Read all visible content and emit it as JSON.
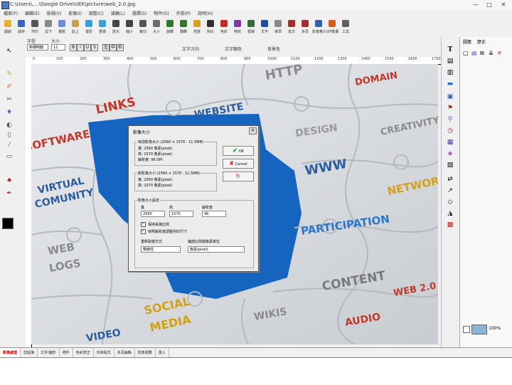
{
  "titlebar": {
    "title": "C:\\Users\\....\\Google Drive\\UEK\\picture\\web_2.0.jpg",
    "minimize": "—",
    "maximize": "□",
    "close": "✕"
  },
  "menubar": [
    "檔案(F)",
    "編輯(E)",
    "檢視(V)",
    "影像(I)",
    "調整(C)",
    "濾鏡(L)",
    "選擇(S)",
    "物件(O)",
    "外掛(P)",
    "說明(H)"
  ],
  "toolbar": [
    {
      "label": "開啟",
      "color": "#e2b23a"
    },
    {
      "label": "儲存",
      "color": "#3a62c0"
    },
    {
      "label": "列印",
      "color": "#555555"
    },
    {
      "label": "剪下",
      "color": "#888888"
    },
    {
      "label": "複製",
      "color": "#6a8fd8"
    },
    {
      "label": "貼上",
      "color": "#c9a04a"
    },
    {
      "label": "復原",
      "color": "#3aa0d8"
    },
    {
      "label": "重做",
      "color": "#3aa0d8"
    },
    {
      "label": "放大",
      "color": "#444444"
    },
    {
      "label": "縮小",
      "color": "#444444"
    },
    {
      "label": "裁切",
      "color": "#555555"
    },
    {
      "label": "大小",
      "color": "#6c6c6c"
    },
    {
      "label": "旋轉",
      "color": "#2d7a2d"
    },
    {
      "label": "翻轉",
      "color": "#2d7a2d"
    },
    {
      "label": "亮度",
      "color": "#d8a020"
    },
    {
      "label": "對比",
      "color": "#303030"
    },
    {
      "label": "色彩",
      "color": "#c02a2a"
    },
    {
      "label": "特效",
      "color": "#7a3aa0"
    },
    {
      "label": "框線",
      "color": "#3a6a3a"
    },
    {
      "label": "文字",
      "color": "#1f4fa0"
    },
    {
      "label": "遮罩",
      "color": "#8a8a8a"
    },
    {
      "label": "批次",
      "color": "#a03030"
    },
    {
      "label": "多頁",
      "color": "#a03030"
    },
    {
      "label": "影像格式",
      "color": "#3060b0"
    },
    {
      "label": "GIF動畫",
      "color": "#d06020"
    },
    {
      "label": "工具",
      "color": "#606060"
    }
  ],
  "textbar": {
    "font_label": "字型",
    "size_label": "大小",
    "font_value": "新細明體",
    "size_value": "12",
    "style_buttons": [
      "B",
      "I",
      "U",
      "S"
    ],
    "align_buttons": [
      "左",
      "中",
      "右"
    ],
    "extra_label_1": "文字方向",
    "extra_label_2": "文字顏色",
    "extra_label_3": "背景色"
  },
  "ruler_numbers": [
    "0",
    "100",
    "200",
    "300",
    "400",
    "500",
    "600",
    "700",
    "800",
    "900",
    "1000",
    "1100",
    "1200",
    "1300",
    "1400",
    "1500",
    "1600",
    "1700"
  ],
  "canvas_words": [
    {
      "text": "HTTP",
      "color": "#8a8a8a"
    },
    {
      "text": "DOMAIN",
      "color": "#c0392b"
    },
    {
      "text": "LINKS",
      "color": "#c0392b"
    },
    {
      "text": "WEBSITE",
      "color": "#2a5d9f"
    },
    {
      "text": "SOFTWARE",
      "color": "#c0392b"
    },
    {
      "text": "DESIGN",
      "color": "#9a9a9a"
    },
    {
      "text": "CREATIVITY",
      "color": "#8a8a8a"
    },
    {
      "text": "WWW",
      "color": "#2a5d9f"
    },
    {
      "text": "NETWORK",
      "color": "#d4a017"
    },
    {
      "text": "VIRTUAL",
      "color": "#2a5d9f"
    },
    {
      "text": "COMUNITY",
      "color": "#2a5d9f"
    },
    {
      "text": "PARTICIPATION",
      "color": "#2a78c8"
    },
    {
      "text": "WEB",
      "color": "#8a8a8a"
    },
    {
      "text": "LOGS",
      "color": "#8a8a8a"
    },
    {
      "text": "CONTENT",
      "color": "#7a7a7a"
    },
    {
      "text": "WEB 2.0",
      "color": "#c0392b"
    },
    {
      "text": "SOCIAL",
      "color": "#d4a017"
    },
    {
      "text": "MEDIA",
      "color": "#d4a017"
    },
    {
      "text": "WIKIS",
      "color": "#8a8a8a"
    },
    {
      "text": "AUDIO",
      "color": "#c0392b"
    },
    {
      "text": "VIDEO",
      "color": "#2a5d9f"
    }
  ],
  "dialog": {
    "title": "影像大小",
    "close": "✕",
    "group1_title": "目前影像大小 (2560 × 1570 · 11.5MB)",
    "width_line": "寬: 2560 像素(pixel)",
    "height_line": "高: 1570 像素(pixel)",
    "res_line": "解析度: 96 DPI",
    "ok_label": "OK",
    "cancel_label": "Cancel",
    "group2_title": "新影像大小 (2560 × 1570 · 11.5MB)",
    "new_width": "寬: 2560 像素(pixel)",
    "new_height": "高: 1570 像素(pixel)",
    "group3_title": "影像大小設定",
    "col_width": "寬",
    "col_height": "高",
    "col_res": "解析度",
    "val_width": "2560",
    "val_height": "1570",
    "val_res": "96",
    "check1": "保持長寬比例",
    "check2": "依照解析度調整列印尺寸",
    "resample_label": "重新取樣方式",
    "unit_label": "縮放比例或像素單位",
    "resample_value": "雙線性",
    "unit_value": "像素(pixel)"
  },
  "right_panel": {
    "tab1": "圖層",
    "tab2": "歷史",
    "zoom": "100%"
  },
  "bottom_tabs": [
    "影像處理",
    "剪貼簿",
    "文字/圖形",
    "物件",
    "色彩修正",
    "外掛程式",
    "多頁編輯",
    "影像瀏覽",
    "匯入"
  ],
  "palette": {
    "fg": "#000000",
    "bg": "#ffffff"
  }
}
